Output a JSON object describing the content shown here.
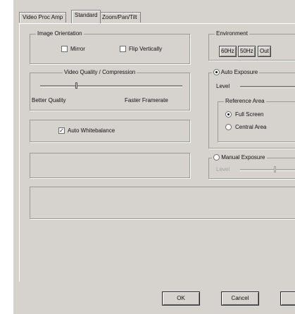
{
  "tabs": [
    {
      "label": "Video Proc Amp",
      "active": false
    },
    {
      "label": "Standard",
      "active": true
    },
    {
      "label": "Zoom/Pan/Tilt",
      "active": false
    }
  ],
  "image_orientation": {
    "title": "Image Orientation",
    "mirror_label": "Mirror",
    "flip_label": "Flip Vertically"
  },
  "video_quality": {
    "title": "Video Quality / Compression",
    "left_label": "Better Quality",
    "right_label": "Faster Framerate",
    "level_fraction": 0.25
  },
  "auto_white": {
    "label": "Auto Whitebalance",
    "checked": "✓"
  },
  "environment": {
    "title": "Environment",
    "buttons": [
      "60Hz",
      "50Hz",
      "Out"
    ]
  },
  "auto_exposure": {
    "label": "Auto Exposure",
    "level_label": "Level",
    "reference_area": {
      "title": "Reference Area",
      "full_screen": "Full Screen",
      "central_area": "Central Area"
    }
  },
  "manual_exposure": {
    "label": "Manual Exposure",
    "level_label": "Level"
  },
  "buttons": {
    "ok": "OK",
    "cancel": "Cancel"
  }
}
